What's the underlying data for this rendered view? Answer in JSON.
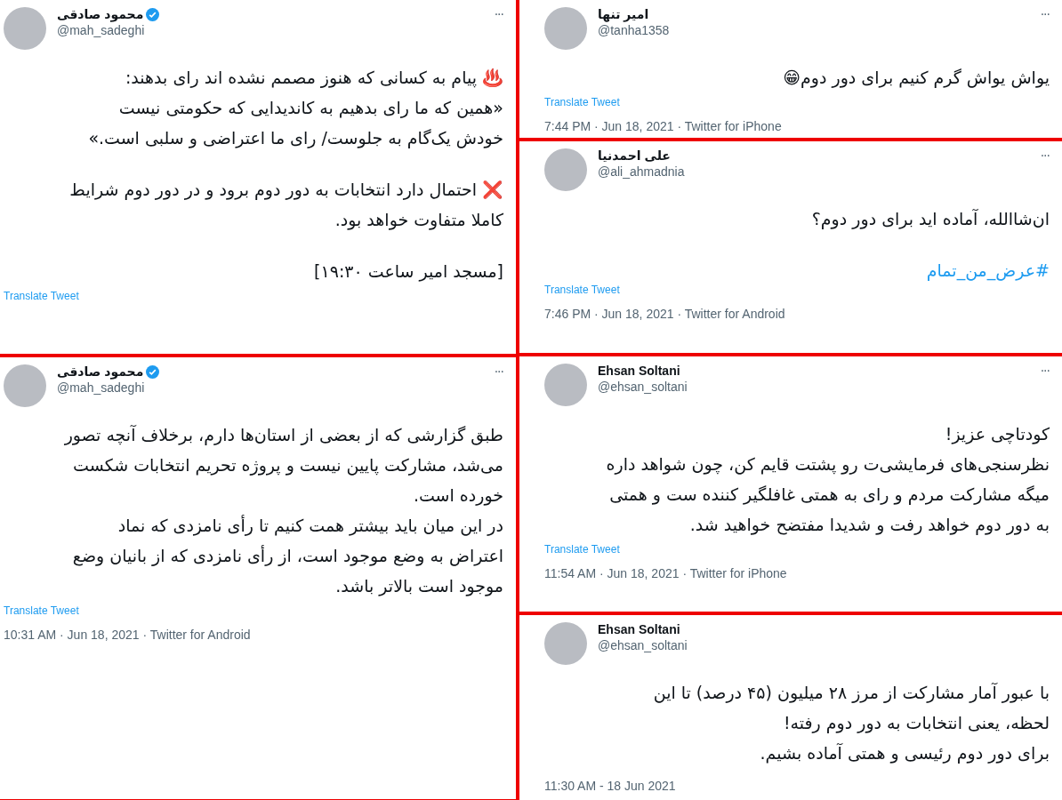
{
  "left_column": {
    "tweets": [
      {
        "name": "محمود صادقی",
        "verified": true,
        "handle": "@mah_sadeghi",
        "more": "···",
        "paragraphs": [
          "♨️ پیام به کسانی که هنوز مصمم نشده اند رای بدهند:\n«همین که ما رای بدهیم به کاندیدایی که حکومتی نیست\nخودش یک‌گام به جلوست/ رای ما اعتراضی و سلبی است.»",
          "❌ احتمال دارد انتخابات به دور دوم برود و در دور دوم شرایط\nکاملا متفاوت خواهد بود.",
          "[مسجد امیر ساعت ۱۹:۳۰]"
        ],
        "translate": "Translate Tweet"
      },
      {
        "name": "محمود صادقی",
        "verified": true,
        "handle": "@mah_sadeghi",
        "more": "···",
        "paragraphs": [
          "طبق گزارشی که از بعضی از استان‌ها دارم، برخلاف آنچه تصور\nمی‌شد، مشارکت پایین نیست و پروژه تحریم انتخابات شکست\nخورده است.\nدر این میان باید بیشتر همت کنیم تا رأی نامزدی که نماد\nاعتراض به وضع موجود است، از رأی نامزدی که از بانیان وضع\nموجود است بالاتر باشد."
        ],
        "translate": "Translate Tweet",
        "meta": "10:31 AM · Jun 18, 2021 · Twitter for Android"
      }
    ]
  },
  "right_column": {
    "tweets": [
      {
        "name": "امیر تنها",
        "verified": false,
        "handle": "@tanha1358",
        "more": "···",
        "paragraphs": [
          "یواش یواش گرم کنیم برای دور دوم😁"
        ],
        "translate": "Translate Tweet",
        "meta": "7:44 PM · Jun 18, 2021 · Twitter for iPhone"
      },
      {
        "name": "علی احمدنیا",
        "verified": false,
        "handle": "@ali_ahmadnia",
        "more": "···",
        "paragraphs": [
          "ان‌شاالله، آماده اید برای دور دوم؟"
        ],
        "hashtag": "#عرض_من_تمام",
        "translate": "Translate Tweet",
        "meta": "7:46 PM · Jun 18, 2021 · Twitter for Android"
      },
      {
        "name": "Ehsan Soltani",
        "verified": false,
        "handle": "@ehsan_soltani",
        "more": "···",
        "paragraphs": [
          "کودتاچی عزیز!\nنظرسنجی‌های فرمایشی‌ت رو پشتت قایم کن، چون شواهد داره\nمیگه مشارکت مردم و رای به همتی غافلگیر کننده ست و همتی\nبه دور دوم خواهد رفت و شدیدا مفتضح خواهید شد."
        ],
        "translate": "Translate Tweet",
        "meta": "11:54 AM · Jun 18, 2021 · Twitter for iPhone"
      },
      {
        "name": "Ehsan Soltani",
        "verified": false,
        "handle": "@ehsan_soltani",
        "paragraphs": [
          "با عبور آمار مشارکت از مرز ۲۸ میلیون (۴۵ درصد) تا این\nلحظه، یعنی انتخابات به دور دوم رفته!\nبرای دور دوم رئیسی و  همتی آماده بشیم."
        ],
        "meta": "11:30 AM - 18 Jun 2021"
      }
    ]
  }
}
